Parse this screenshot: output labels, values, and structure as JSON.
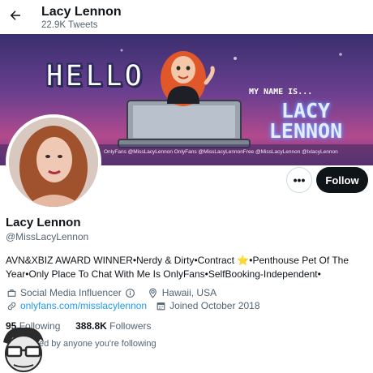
{
  "header": {
    "title": "Lacy Lennon",
    "subtitle": "22.9K Tweets",
    "back_icon": "arrow-left-icon"
  },
  "banner": {
    "hello_text": "HELLO",
    "my_name_is": "MY NAME IS...",
    "name_text": "LACY LENNON",
    "handles": "OnlyFans @MissLacyLennon OnlyFans @MissLacyLennonFree  @MissLacyLennon  @lxlacyLennon"
  },
  "actions": {
    "more_label": "•••",
    "follow_label": "Follow"
  },
  "profile": {
    "name": "Lacy Lennon",
    "handle": "@MissLacyLennon",
    "bio_part1": "AVN&XBIZ AWARD WINNER•Nerdy & Dirty•Contract ",
    "bio_star": "⭐",
    "bio_part2": "•Penthouse Pet Of The Year•Only Place To Chat With Me Is OnlyFans•SelfBooking-Independent•",
    "category": "Social Media Influencer",
    "location": "Hawaii, USA",
    "website": "onlyfans.com/misslacylennon",
    "joined": "Joined October 2018"
  },
  "stats": {
    "following_count": "95",
    "following_label": "Following",
    "followers_count": "388.8K",
    "followers_label": "Followers"
  },
  "followed_by": "ed by anyone you're following",
  "colors": {
    "accent": "#1d9bf0",
    "text_primary": "#0f1419",
    "text_secondary": "#536471",
    "follow_button": "#0f1419",
    "banner_base": "#6a3f8f"
  }
}
